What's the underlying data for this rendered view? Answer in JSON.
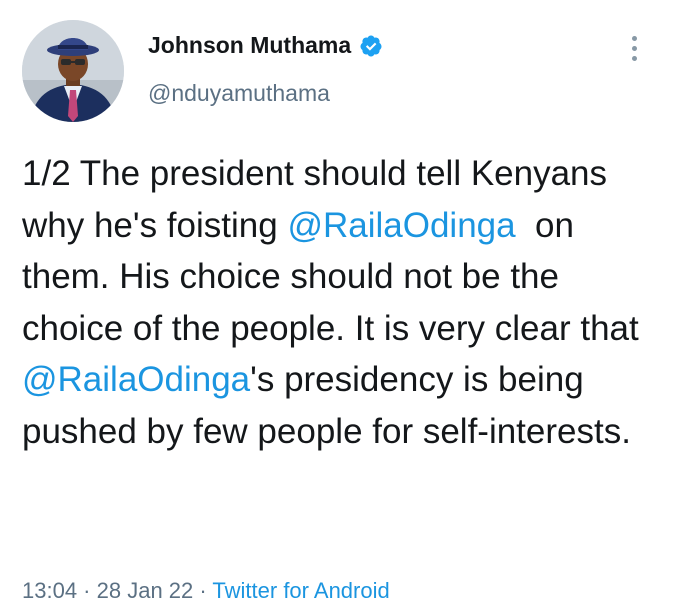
{
  "author": {
    "display_name": "Johnson Muthama",
    "handle": "@nduyamuthama",
    "verified": true
  },
  "tweet": {
    "segments": [
      {
        "type": "text",
        "value": "1/2 The president should tell Kenyans why he's foisting "
      },
      {
        "type": "mention",
        "value": "@RailaOdinga"
      },
      {
        "type": "text",
        "value": "  on them. His choice should not be the choice of the people. It is very clear that "
      },
      {
        "type": "mention",
        "value": "@RailaOdinga"
      },
      {
        "type": "text",
        "value": "'s presidency is being pushed by few people for self-interests."
      }
    ]
  },
  "meta": {
    "time": "13:04",
    "separator1": " · ",
    "date": "28 Jan 22",
    "separator2": " · ",
    "source": "Twitter for Android"
  },
  "icons": {
    "verified": "verified-badge-icon",
    "more": "more-vertical-icon"
  },
  "colors": {
    "link": "#1b95e0",
    "secondary_text": "#5b7083",
    "primary_text": "#14171a",
    "verified": "#1da1f2"
  }
}
